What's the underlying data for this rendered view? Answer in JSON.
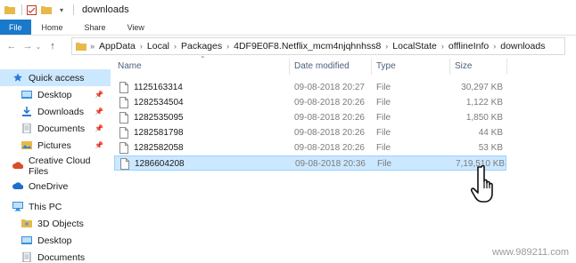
{
  "window": {
    "title": "downloads"
  },
  "ribbon": {
    "tabs": [
      "File",
      "Home",
      "Share",
      "View"
    ]
  },
  "address": {
    "crumbs": [
      "AppData",
      "Local",
      "Packages",
      "4DF9E0F8.Netflix_mcm4njqhnhss8",
      "LocalState",
      "offlineInfo",
      "downloads"
    ]
  },
  "sidebar": {
    "items": [
      {
        "label": "Quick access",
        "icon": "star-icon",
        "pinned": false
      },
      {
        "label": "Desktop",
        "icon": "folder-icon",
        "pinned": true
      },
      {
        "label": "Downloads",
        "icon": "download-icon",
        "pinned": true
      },
      {
        "label": "Documents",
        "icon": "documents-icon",
        "pinned": true
      },
      {
        "label": "Pictures",
        "icon": "pictures-icon",
        "pinned": true
      },
      {
        "label": "Creative Cloud Files",
        "icon": "creative-cloud-icon",
        "pinned": false
      },
      {
        "label": "OneDrive",
        "icon": "cloud-icon",
        "pinned": false
      },
      {
        "label": "This PC",
        "icon": "computer-icon",
        "pinned": false
      },
      {
        "label": "3D Objects",
        "icon": "folder-3d-icon",
        "pinned": false
      },
      {
        "label": "Desktop",
        "icon": "folder-icon",
        "pinned": false
      },
      {
        "label": "Documents",
        "icon": "documents-icon",
        "pinned": false
      }
    ]
  },
  "columns": {
    "name": "Name",
    "date": "Date modified",
    "type": "Type",
    "size": "Size"
  },
  "files": [
    {
      "name": "1125163314",
      "date": "09-08-2018 20:27",
      "type": "File",
      "size": "30,297 KB"
    },
    {
      "name": "1282534504",
      "date": "09-08-2018 20:26",
      "type": "File",
      "size": "1,122 KB"
    },
    {
      "name": "1282535095",
      "date": "09-08-2018 20:26",
      "type": "File",
      "size": "1,850 KB"
    },
    {
      "name": "1282581798",
      "date": "09-08-2018 20:26",
      "type": "File",
      "size": "44 KB"
    },
    {
      "name": "1282582058",
      "date": "09-08-2018 20:26",
      "type": "File",
      "size": "53 KB"
    },
    {
      "name": "1286604208",
      "date": "09-08-2018 20:36",
      "type": "File",
      "size": "7,19,510 KB"
    }
  ],
  "selected_file_index": 5,
  "watermark": "www.989211.com",
  "colors": {
    "accent": "#1979ca",
    "selection": "#cce8ff",
    "header_text": "#4c607a",
    "folder": "#e8b84a"
  }
}
